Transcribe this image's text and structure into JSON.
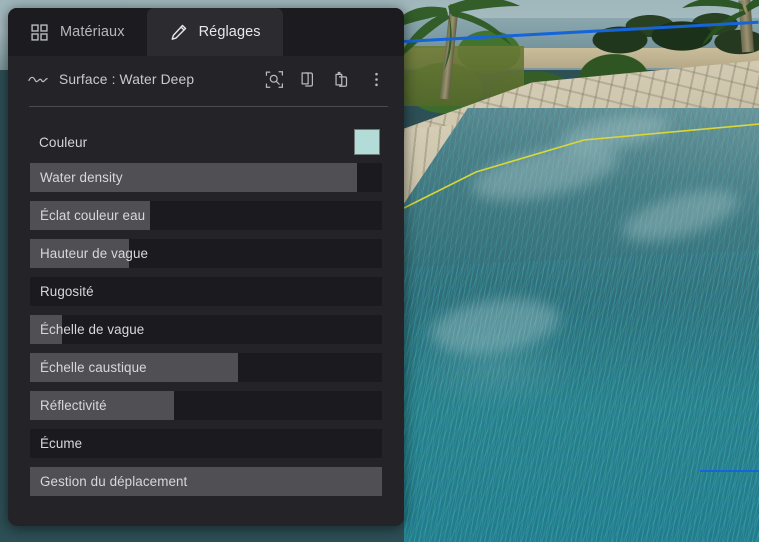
{
  "app": {
    "panel_title": "Surface : Water Deep",
    "wave_icon": "wave-icon"
  },
  "tabs": [
    {
      "label": "Matériaux",
      "icon": "grid-icon",
      "active": false
    },
    {
      "label": "Réglages",
      "icon": "pencil-icon",
      "active": true
    }
  ],
  "toolbar": {
    "buttons": [
      {
        "name": "locate-material-button",
        "icon": "target-search-icon"
      },
      {
        "name": "copy-button",
        "icon": "copy-icon"
      },
      {
        "name": "paste-button",
        "icon": "paste-icon"
      },
      {
        "name": "more-options-button",
        "icon": "more-vertical-icon"
      }
    ]
  },
  "properties": {
    "color_row": {
      "label": "Couleur",
      "swatch_color": "#b3dcd8"
    },
    "sliders": [
      {
        "label": "Water density",
        "fill_percent": 93
      },
      {
        "label": "Éclat couleur eau",
        "fill_percent": 34
      },
      {
        "label": "Hauteur de vague",
        "fill_percent": 28
      },
      {
        "label": "Rugosité",
        "fill_percent": 0
      },
      {
        "label": "Échelle de vague",
        "fill_percent": 9
      },
      {
        "label": "Échelle caustique",
        "fill_percent": 59
      },
      {
        "label": "Réflectivité",
        "fill_percent": 41
      },
      {
        "label": "Écume",
        "fill_percent": 0
      },
      {
        "label": "Gestion du déplacement",
        "fill_percent": 100
      }
    ]
  },
  "viewport": {
    "scene_description": "Rendu 3D : plage tropicale avec palmiers, allée pavée et surface d'eau sélectionnée",
    "selection_outline_color": "#d8d836",
    "gizmo_color": "#1565d8"
  },
  "theme": {
    "panel_bg": "#242428",
    "tabbar_bg": "#1c1c20",
    "tab_active_bg": "#2b2b30",
    "slider_track": "#1b1b1f",
    "slider_fill": "#4f4f54",
    "text": "#d7d8dc"
  }
}
